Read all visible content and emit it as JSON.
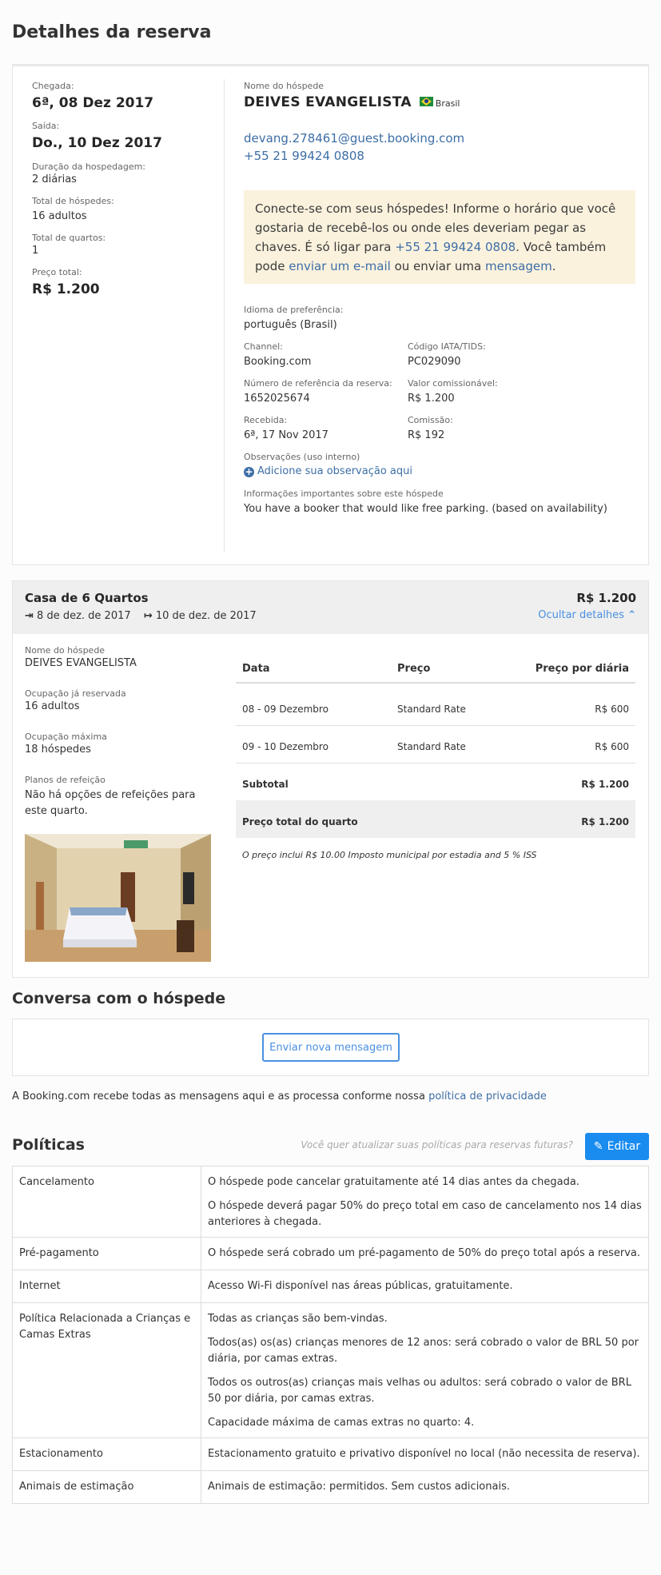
{
  "page_title": "Detalhes da reserva",
  "booking": {
    "arrival_label": "Chegada:",
    "arrival": "6ª, 08 Dez 2017",
    "departure_label": "Saída:",
    "departure": "Do., 10 Dez 2017",
    "duration_label": "Duração da hospedagem:",
    "duration": "2 diárias",
    "guests_label": "Total de hóspedes:",
    "guests": "16 adultos",
    "rooms_label": "Total de quartos:",
    "rooms": "1",
    "price_label": "Preço total:",
    "price": "R$ 1.200"
  },
  "guest": {
    "name_label": "Nome do hóspede",
    "name": "DEIVES EVANGELISTA",
    "country": "Brasil",
    "email": "devang.278461@guest.booking.com",
    "phone": "+55 21 99424 0808"
  },
  "notice": {
    "t1": "Conecte-se com seus hóspedes! Informe o horário que você gostaria de recebê-los ou onde eles deveriam pegar as chaves. É só ligar para ",
    "phone": "+55 21 99424 0808",
    "t2": ". Você também pode ",
    "email_link": "enviar um e-mail",
    "t3": " ou enviar uma ",
    "msg_link": "mensagem",
    "t4": "."
  },
  "details": {
    "lang_label": "Idioma de preferência:",
    "lang": "português (Brasil)",
    "channel_label": "Channel:",
    "channel": "Booking.com",
    "iata_label": "Código IATA/TIDS:",
    "iata": "PC029090",
    "ref_label": "Número de referência da reserva:",
    "ref": "1652025674",
    "commissionable_label": "Valor comissionável:",
    "commissionable": "R$ 1.200",
    "received_label": "Recebida:",
    "received": "6ª, 17 Nov 2017",
    "commission_label": "Comissão:",
    "commission": "R$ 192",
    "notes_label": "Observações (uso interno)",
    "notes_link": "Adicione sua observação aqui",
    "info_label": "Informações importantes sobre este hóspede",
    "info": "You have a booker that would like free parking. (based on availability)"
  },
  "room": {
    "title": "Casa de 6 Quartos",
    "checkin": "8 de dez. de 2017",
    "checkout": "10 de dez. de 2017",
    "price": "R$ 1.200",
    "toggle": "Ocultar detalhes",
    "guest_label": "Nome do hóspede",
    "guest": "DEIVES EVANGELISTA",
    "occ_label": "Ocupação já reservada",
    "occ": "16 adultos",
    "max_label": "Ocupação máxima",
    "max": "18 hóspedes",
    "meal_label": "Planos de refeição",
    "meal": "Não há opções de refeições para este quarto.",
    "table": {
      "headers": [
        "Data",
        "Preço",
        "Preço por diária"
      ],
      "rows": [
        {
          "date": "08 - 09 Dezembro",
          "rate": "Standard Rate",
          "price": "R$ 600"
        },
        {
          "date": "09 - 10 Dezembro",
          "rate": "Standard Rate",
          "price": "R$ 600"
        }
      ],
      "subtotal_label": "Subtotal",
      "subtotal": "R$ 1.200",
      "total_label": "Preço total do quarto",
      "total": "R$ 1.200",
      "note": "O preço inclui R$ 10.00 Imposto municipal por estadia and 5 % ISS"
    }
  },
  "conversation": {
    "title": "Conversa com o hóspede",
    "button": "Enviar nova mensagem",
    "privacy_text": "A Booking.com recebe todas as mensagens aqui e as processa conforme nossa ",
    "privacy_link": "política de privacidade"
  },
  "policies": {
    "title": "Políticas",
    "question": "Você quer atualizar suas políticas para reservas futuras?",
    "edit": "Editar",
    "rows": [
      {
        "name": "Cancelamento",
        "lines": [
          "O hóspede pode cancelar gratuitamente até 14 dias antes da chegada.",
          "O hóspede deverá pagar 50% do preço total em caso de cancelamento nos 14 dias anteriores à chegada."
        ]
      },
      {
        "name": "Pré-pagamento",
        "lines": [
          "O hóspede será cobrado um pré-pagamento de 50% do preço total após a reserva."
        ]
      },
      {
        "name": "Internet",
        "lines": [
          "Acesso Wi-Fi disponível nas áreas públicas, gratuitamente."
        ]
      },
      {
        "name": "Política Relacionada a Crianças e Camas Extras",
        "lines": [
          "Todas as crianças são bem-vindas.",
          "Todos(as) os(as) crianças menores de 12 anos: será cobrado o valor de BRL 50 por diária, por camas extras.",
          "Todos os outros(as) crianças mais velhas ou adultos: será cobrado o valor de BRL 50 por diária, por camas extras.",
          "Capacidade máxima de camas extras no quarto: 4."
        ]
      },
      {
        "name": "Estacionamento",
        "lines": [
          "Estacionamento gratuito e privativo disponível no local (não necessita de reserva)."
        ]
      },
      {
        "name": "Animais de estimação",
        "lines": [
          "Animais de estimação: permitidos. Sem custos adicionais."
        ]
      }
    ]
  }
}
